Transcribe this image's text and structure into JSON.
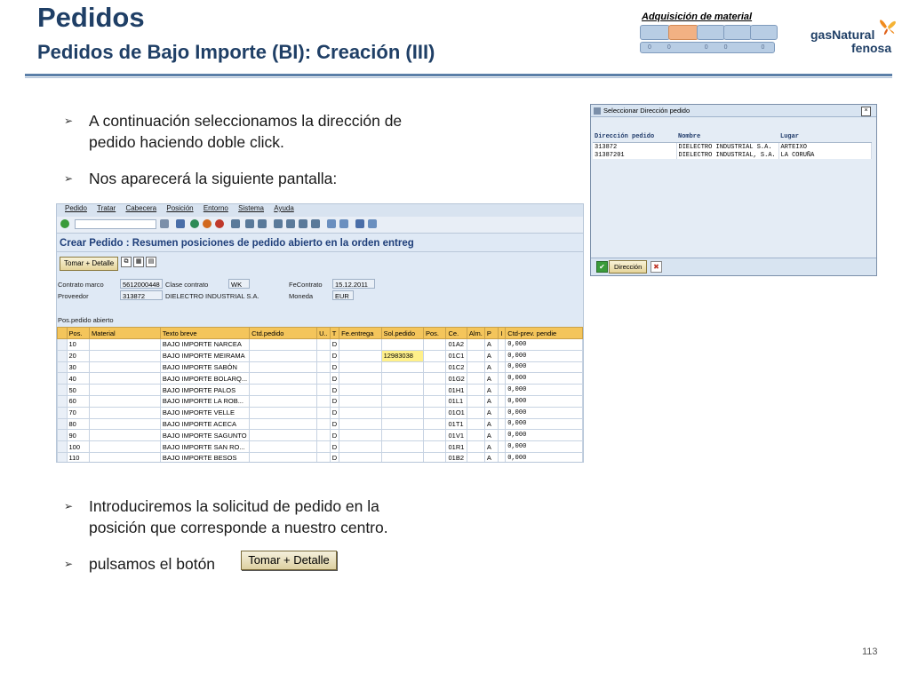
{
  "header": {
    "title": "Pedidos",
    "subtitle": "Pedidos de Bajo Importe (BI): Creación (III)",
    "process_title": "Adquisición de material",
    "process_steps": "00 00 00 00 00",
    "logo_line1": "gasNatural",
    "logo_line2": "fenosa",
    "accent_color": "#1f3f66"
  },
  "bullets": {
    "b1_line1": "A continuación seleccionamos la dirección de",
    "b1_line2": "pedido haciendo doble click.",
    "b2": "Nos aparecerá la siguiente pantalla:",
    "b3_line1": "Introduciremos la solicitud de pedido en la",
    "b3_line2": "posición que corresponde a nuestro centro.",
    "b4": "pulsamos el botón",
    "button_label": "Tomar + Detalle"
  },
  "sap_screen": {
    "menu": [
      "Pedido",
      "Tratar",
      "Cabecera",
      "Posición",
      "Entorno",
      "Sistema",
      "Ayuda"
    ],
    "screen_title": "Crear Pedido : Resumen posiciones de pedido abierto en la orden entreg",
    "toolbar_button": "Tomar + Detalle",
    "labels": {
      "contrato_marco": "Contrato marco",
      "proveedor": "Proveedor",
      "clase_contrato": "Clase contrato",
      "fe_contrato": "FeContrato",
      "moneda": "Moneda",
      "pos_pedido_abierto": "Pos.pedido abierto"
    },
    "values": {
      "contrato_marco": "5612000448",
      "proveedor": "313872",
      "proveedor_nombre": "DIELECTRO INDUSTRIAL S.A.",
      "clase_contrato": "WK",
      "fe_contrato": "15.12.2011",
      "moneda": "EUR"
    },
    "columns": [
      "Pos.",
      "Material",
      "Texto breve",
      "Ctd.pedido",
      "U..",
      "T",
      "Fe.entrega",
      "Sol.pedido",
      "Pos.",
      "Ce.",
      "Alm.",
      "P",
      "I",
      "Ctd-prev. pendie"
    ],
    "rows": [
      {
        "pos": "10",
        "texto": "BAJO IMPORTE NARCEA",
        "t": "D",
        "sol": "",
        "ce": "01A2",
        "p": "A",
        "ctd": "0,000"
      },
      {
        "pos": "20",
        "texto": "BAJO IMPORTE MEIRAMA",
        "t": "D",
        "sol": "12983038",
        "ce": "01C1",
        "p": "A",
        "ctd": "0,000"
      },
      {
        "pos": "30",
        "texto": "BAJO IMPORTE SABÓN",
        "t": "D",
        "sol": "",
        "ce": "01C2",
        "p": "A",
        "ctd": "0,000"
      },
      {
        "pos": "40",
        "texto": "BAJO IMPORTE BOLARQ...",
        "t": "D",
        "sol": "",
        "ce": "01G2",
        "p": "A",
        "ctd": "0,000"
      },
      {
        "pos": "50",
        "texto": "BAJO IMPORTE PALOS",
        "t": "D",
        "sol": "",
        "ce": "01H1",
        "p": "A",
        "ctd": "0,000"
      },
      {
        "pos": "60",
        "texto": "BAJO IMPORTE LA ROB...",
        "t": "D",
        "sol": "",
        "ce": "01L1",
        "p": "A",
        "ctd": "0,000"
      },
      {
        "pos": "70",
        "texto": "BAJO IMPORTE VELLE",
        "t": "D",
        "sol": "",
        "ce": "01O1",
        "p": "A",
        "ctd": "0,000"
      },
      {
        "pos": "80",
        "texto": "BAJO IMPORTE ACECA",
        "t": "D",
        "sol": "",
        "ce": "01T1",
        "p": "A",
        "ctd": "0,000"
      },
      {
        "pos": "90",
        "texto": "BAJO IMPORTE SAGUNTO",
        "t": "D",
        "sol": "",
        "ce": "01V1",
        "p": "A",
        "ctd": "0,000"
      },
      {
        "pos": "100",
        "texto": "BAJO IMPORTE SAN RO...",
        "t": "D",
        "sol": "",
        "ce": "01R1",
        "p": "A",
        "ctd": "0,000"
      },
      {
        "pos": "110",
        "texto": "BAJO IMPORTE BESOS",
        "t": "D",
        "sol": "",
        "ce": "01B2",
        "p": "A",
        "ctd": "0,000"
      }
    ]
  },
  "popup": {
    "title": "Seleccionar Dirección pedido",
    "close_glyph": "×",
    "columns": [
      "Dirección pedido",
      "Nombre",
      "Lugar"
    ],
    "rows": [
      {
        "dir": "313872",
        "nombre": "DIELECTRO INDUSTRIAL S.A.",
        "lugar": "ARTEIXO"
      },
      {
        "dir": "31387201",
        "nombre": "DIELECTRO INDUSTRIAL, S.A.",
        "lugar": "LA CORUÑA"
      }
    ],
    "ok_button": "Dirección",
    "cancel_glyph": "✖"
  },
  "footer": {
    "page_number": "113"
  }
}
